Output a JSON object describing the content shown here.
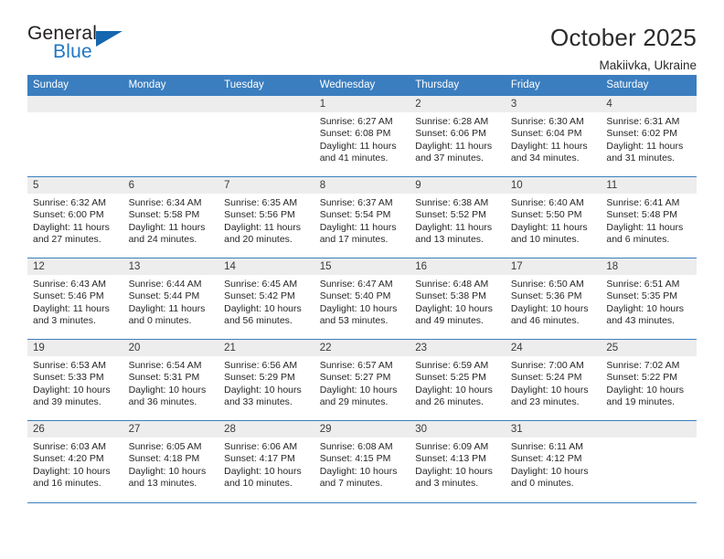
{
  "logo": {
    "general": "General",
    "blue": "Blue",
    "triangle_color": "#1566ae"
  },
  "header": {
    "title": "October 2025",
    "subtitle": "Makiivka, Ukraine"
  },
  "colors": {
    "header_band": "#3b7ebf",
    "daynum_band": "#ededed",
    "text": "#262626"
  },
  "weekdays": [
    "Sunday",
    "Monday",
    "Tuesday",
    "Wednesday",
    "Thursday",
    "Friday",
    "Saturday"
  ],
  "weeks": [
    [
      {
        "day": "",
        "sunrise": "",
        "sunset": "",
        "daylight": ""
      },
      {
        "day": "",
        "sunrise": "",
        "sunset": "",
        "daylight": ""
      },
      {
        "day": "",
        "sunrise": "",
        "sunset": "",
        "daylight": ""
      },
      {
        "day": "1",
        "sunrise": "Sunrise: 6:27 AM",
        "sunset": "Sunset: 6:08 PM",
        "daylight": "Daylight: 11 hours and 41 minutes."
      },
      {
        "day": "2",
        "sunrise": "Sunrise: 6:28 AM",
        "sunset": "Sunset: 6:06 PM",
        "daylight": "Daylight: 11 hours and 37 minutes."
      },
      {
        "day": "3",
        "sunrise": "Sunrise: 6:30 AM",
        "sunset": "Sunset: 6:04 PM",
        "daylight": "Daylight: 11 hours and 34 minutes."
      },
      {
        "day": "4",
        "sunrise": "Sunrise: 6:31 AM",
        "sunset": "Sunset: 6:02 PM",
        "daylight": "Daylight: 11 hours and 31 minutes."
      }
    ],
    [
      {
        "day": "5",
        "sunrise": "Sunrise: 6:32 AM",
        "sunset": "Sunset: 6:00 PM",
        "daylight": "Daylight: 11 hours and 27 minutes."
      },
      {
        "day": "6",
        "sunrise": "Sunrise: 6:34 AM",
        "sunset": "Sunset: 5:58 PM",
        "daylight": "Daylight: 11 hours and 24 minutes."
      },
      {
        "day": "7",
        "sunrise": "Sunrise: 6:35 AM",
        "sunset": "Sunset: 5:56 PM",
        "daylight": "Daylight: 11 hours and 20 minutes."
      },
      {
        "day": "8",
        "sunrise": "Sunrise: 6:37 AM",
        "sunset": "Sunset: 5:54 PM",
        "daylight": "Daylight: 11 hours and 17 minutes."
      },
      {
        "day": "9",
        "sunrise": "Sunrise: 6:38 AM",
        "sunset": "Sunset: 5:52 PM",
        "daylight": "Daylight: 11 hours and 13 minutes."
      },
      {
        "day": "10",
        "sunrise": "Sunrise: 6:40 AM",
        "sunset": "Sunset: 5:50 PM",
        "daylight": "Daylight: 11 hours and 10 minutes."
      },
      {
        "day": "11",
        "sunrise": "Sunrise: 6:41 AM",
        "sunset": "Sunset: 5:48 PM",
        "daylight": "Daylight: 11 hours and 6 minutes."
      }
    ],
    [
      {
        "day": "12",
        "sunrise": "Sunrise: 6:43 AM",
        "sunset": "Sunset: 5:46 PM",
        "daylight": "Daylight: 11 hours and 3 minutes."
      },
      {
        "day": "13",
        "sunrise": "Sunrise: 6:44 AM",
        "sunset": "Sunset: 5:44 PM",
        "daylight": "Daylight: 11 hours and 0 minutes."
      },
      {
        "day": "14",
        "sunrise": "Sunrise: 6:45 AM",
        "sunset": "Sunset: 5:42 PM",
        "daylight": "Daylight: 10 hours and 56 minutes."
      },
      {
        "day": "15",
        "sunrise": "Sunrise: 6:47 AM",
        "sunset": "Sunset: 5:40 PM",
        "daylight": "Daylight: 10 hours and 53 minutes."
      },
      {
        "day": "16",
        "sunrise": "Sunrise: 6:48 AM",
        "sunset": "Sunset: 5:38 PM",
        "daylight": "Daylight: 10 hours and 49 minutes."
      },
      {
        "day": "17",
        "sunrise": "Sunrise: 6:50 AM",
        "sunset": "Sunset: 5:36 PM",
        "daylight": "Daylight: 10 hours and 46 minutes."
      },
      {
        "day": "18",
        "sunrise": "Sunrise: 6:51 AM",
        "sunset": "Sunset: 5:35 PM",
        "daylight": "Daylight: 10 hours and 43 minutes."
      }
    ],
    [
      {
        "day": "19",
        "sunrise": "Sunrise: 6:53 AM",
        "sunset": "Sunset: 5:33 PM",
        "daylight": "Daylight: 10 hours and 39 minutes."
      },
      {
        "day": "20",
        "sunrise": "Sunrise: 6:54 AM",
        "sunset": "Sunset: 5:31 PM",
        "daylight": "Daylight: 10 hours and 36 minutes."
      },
      {
        "day": "21",
        "sunrise": "Sunrise: 6:56 AM",
        "sunset": "Sunset: 5:29 PM",
        "daylight": "Daylight: 10 hours and 33 minutes."
      },
      {
        "day": "22",
        "sunrise": "Sunrise: 6:57 AM",
        "sunset": "Sunset: 5:27 PM",
        "daylight": "Daylight: 10 hours and 29 minutes."
      },
      {
        "day": "23",
        "sunrise": "Sunrise: 6:59 AM",
        "sunset": "Sunset: 5:25 PM",
        "daylight": "Daylight: 10 hours and 26 minutes."
      },
      {
        "day": "24",
        "sunrise": "Sunrise: 7:00 AM",
        "sunset": "Sunset: 5:24 PM",
        "daylight": "Daylight: 10 hours and 23 minutes."
      },
      {
        "day": "25",
        "sunrise": "Sunrise: 7:02 AM",
        "sunset": "Sunset: 5:22 PM",
        "daylight": "Daylight: 10 hours and 19 minutes."
      }
    ],
    [
      {
        "day": "26",
        "sunrise": "Sunrise: 6:03 AM",
        "sunset": "Sunset: 4:20 PM",
        "daylight": "Daylight: 10 hours and 16 minutes."
      },
      {
        "day": "27",
        "sunrise": "Sunrise: 6:05 AM",
        "sunset": "Sunset: 4:18 PM",
        "daylight": "Daylight: 10 hours and 13 minutes."
      },
      {
        "day": "28",
        "sunrise": "Sunrise: 6:06 AM",
        "sunset": "Sunset: 4:17 PM",
        "daylight": "Daylight: 10 hours and 10 minutes."
      },
      {
        "day": "29",
        "sunrise": "Sunrise: 6:08 AM",
        "sunset": "Sunset: 4:15 PM",
        "daylight": "Daylight: 10 hours and 7 minutes."
      },
      {
        "day": "30",
        "sunrise": "Sunrise: 6:09 AM",
        "sunset": "Sunset: 4:13 PM",
        "daylight": "Daylight: 10 hours and 3 minutes."
      },
      {
        "day": "31",
        "sunrise": "Sunrise: 6:11 AM",
        "sunset": "Sunset: 4:12 PM",
        "daylight": "Daylight: 10 hours and 0 minutes."
      },
      {
        "day": "",
        "sunrise": "",
        "sunset": "",
        "daylight": ""
      }
    ]
  ]
}
